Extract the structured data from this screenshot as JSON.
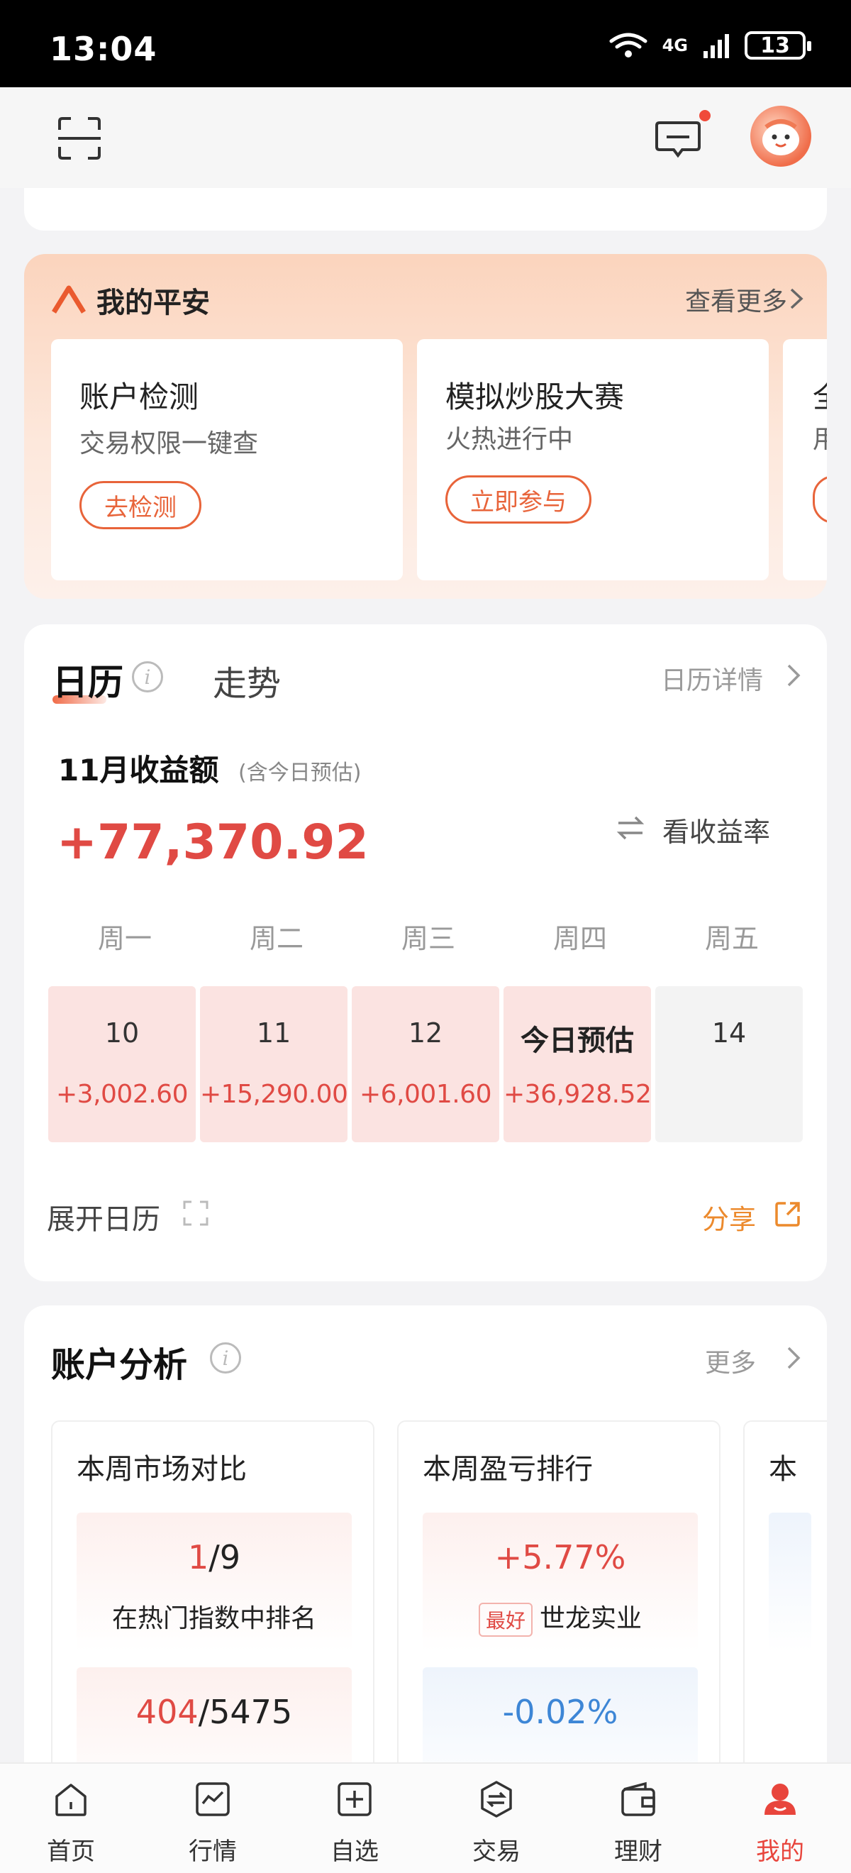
{
  "status_bar": {
    "time": "13:04",
    "network": "4G",
    "battery": "13"
  },
  "pingan": {
    "title": "我的平安",
    "more": "查看更多",
    "cards": [
      {
        "title": "账户检测",
        "subtitle": "交易权限一键查",
        "button": "去检测"
      },
      {
        "title": "模拟炒股大赛",
        "subtitle": "火热进行中",
        "button": "立即参与"
      },
      {
        "title": "全",
        "subtitle": "用"
      }
    ]
  },
  "calendar": {
    "tab_active": "日历",
    "tab_other": "走势",
    "detail_link": "日历详情",
    "month_label": "11月收益额",
    "month_note": "(含今日预估)",
    "amount": "+77,370.92",
    "rate_toggle": "看收益率",
    "weekdays": [
      "周一",
      "周二",
      "周三",
      "周四",
      "周五"
    ],
    "days": [
      {
        "day": "10",
        "value": "+3,002.60"
      },
      {
        "day": "11",
        "value": "+15,290.00"
      },
      {
        "day": "12",
        "value": "+6,001.60"
      },
      {
        "day": "今日预估",
        "value": "+36,928.52"
      },
      {
        "day": "14",
        "value": ""
      }
    ],
    "expand": "展开日历",
    "share": "分享",
    "colors": {
      "positive": "#e04a44",
      "accent": "#ec8a2d"
    }
  },
  "analysis": {
    "title": "账户分析",
    "more": "更多",
    "cards": [
      {
        "title": "本周市场对比",
        "box1_rank": "1",
        "box1_total": "/9",
        "box1_label": "在热门指数中排名",
        "box2_rank": "404",
        "box2_total": "/5475"
      },
      {
        "title": "本周盈亏排行",
        "box1_value": "+5.77%",
        "box1_tag": "最好",
        "box1_label": "世龙实业",
        "box2_value": "-0.02%"
      },
      {
        "title": "本"
      }
    ]
  },
  "bottom_nav": [
    {
      "label": "首页",
      "icon": "home-icon"
    },
    {
      "label": "行情",
      "icon": "chart-icon"
    },
    {
      "label": "自选",
      "icon": "add-watchlist-icon"
    },
    {
      "label": "交易",
      "icon": "exchange-icon"
    },
    {
      "label": "理财",
      "icon": "wallet-icon"
    },
    {
      "label": "我的",
      "icon": "profile-icon",
      "active": true
    }
  ]
}
